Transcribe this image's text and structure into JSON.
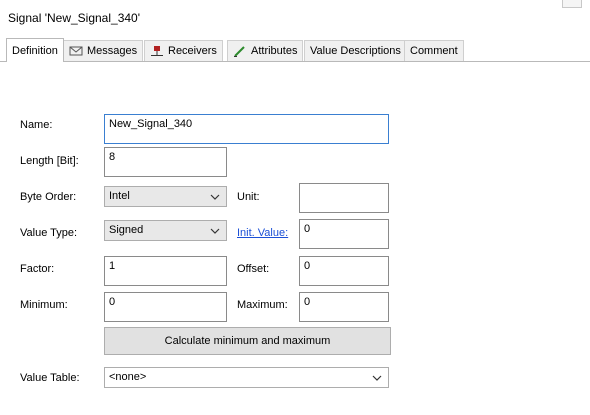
{
  "window": {
    "title": "Signal 'New_Signal_340'"
  },
  "tabs": [
    {
      "label": "Definition",
      "icon": "none"
    },
    {
      "label": "Messages",
      "icon": "envelope-icon"
    },
    {
      "label": "Receivers",
      "icon": "receiver-node-icon"
    },
    {
      "label": "Attributes",
      "icon": "pencil-icon"
    },
    {
      "label": "Value Descriptions",
      "icon": "none"
    },
    {
      "label": "Comment",
      "icon": "none"
    }
  ],
  "form": {
    "name": {
      "label": "Name:",
      "value": "New_Signal_340"
    },
    "length": {
      "label": "Length [Bit]:",
      "value": "8"
    },
    "byte_order": {
      "label": "Byte Order:",
      "value": "Intel"
    },
    "unit": {
      "label": "Unit:",
      "value": ""
    },
    "value_type": {
      "label": "Value Type:",
      "value": "Signed"
    },
    "init_value": {
      "label": "Init. Value:",
      "value": "0"
    },
    "factor": {
      "label": "Factor:",
      "value": "1"
    },
    "offset": {
      "label": "Offset:",
      "value": "0"
    },
    "minimum": {
      "label": "Minimum:",
      "value": "0"
    },
    "maximum": {
      "label": "Maximum:",
      "value": "0"
    },
    "calc_button": {
      "label": "Calculate minimum and maximum"
    },
    "value_table": {
      "label": "Value Table:",
      "value": "<none>"
    }
  },
  "colors": {
    "link": "#1b4fd6",
    "focus_border": "#3a7fd1",
    "receiver_icon": "#b22222",
    "pencil_icon": "#2e8b2e"
  }
}
